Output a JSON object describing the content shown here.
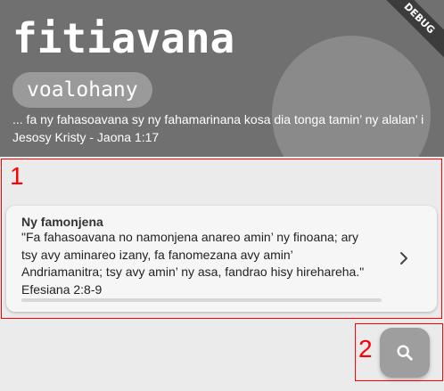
{
  "header": {
    "title": "fitiavana",
    "chip_label": "voalohany",
    "verse_line1": "... fa ny fahasoavana sy ny fahamarinana kosa dia tonga tamin’ ny alalan’ i",
    "verse_line2": "Jesosy Kristy - Jaona 1:17",
    "debug_label": "DEBUG"
  },
  "markers": {
    "one": "1",
    "two": "2"
  },
  "card": {
    "title": "Ny famonjena",
    "lines": [
      "\"Fa fahasoavana no namonjena anareo amin’ ny finoana; ary",
      "tsy avy aminareo izany, fa fanomezana avy amin’",
      "Andriamanitra; tsy avy amin’ ny asa, fandrao hisy hirehareha.\"",
      "Efesiana 2:8-9"
    ],
    "icon": "chevron-right-icon"
  },
  "fab": {
    "icon": "search-icon"
  },
  "colors": {
    "header_bg": "#707070",
    "chip_bg": "#9a9a9a",
    "page_bg": "#ebebeb",
    "card_bg": "#f6f6f6",
    "fab_bg": "#9e9e9e",
    "marker": "#ff0000"
  }
}
